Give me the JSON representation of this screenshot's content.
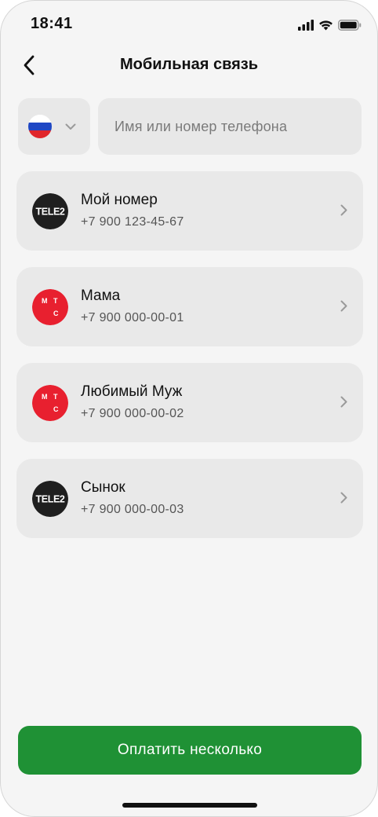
{
  "status_bar": {
    "time": "18:41"
  },
  "nav": {
    "title": "Мобильная связь",
    "back_icon": "chevron-left-icon"
  },
  "country_select": {
    "flag": "russia-flag-icon",
    "dropdown_icon": "chevron-down-icon"
  },
  "search": {
    "value": "",
    "placeholder": "Имя или номер телефона"
  },
  "contacts": [
    {
      "operator": "tele2",
      "name": "Мой номер",
      "phone": "+7 900 123-45-67"
    },
    {
      "operator": "mts",
      "name": "Мама",
      "phone": "+7 900 000-00-01"
    },
    {
      "operator": "mts",
      "name": "Любимый Муж",
      "phone": "+7 900 000-00-02"
    },
    {
      "operator": "tele2",
      "name": "Сынок",
      "phone": "+7 900 000-00-03"
    }
  ],
  "operators": {
    "tele2": {
      "logo_text": "TELE2",
      "color": "#1f1f1f"
    },
    "mts": {
      "logo_text": "МТС",
      "color": "#e8202f"
    }
  },
  "pay_button": {
    "label": "Оплатить несколько"
  },
  "colors": {
    "accent": "#1f9135",
    "background": "#f5f5f5",
    "card": "#e9e9e9"
  }
}
